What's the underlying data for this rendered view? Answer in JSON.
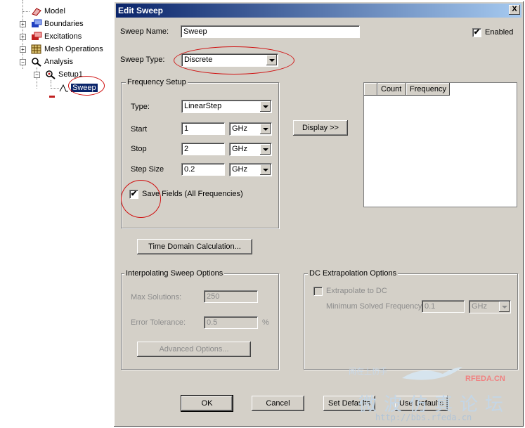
{
  "tree": {
    "items": [
      {
        "label": "Model",
        "icon": "model-icon"
      },
      {
        "label": "Boundaries",
        "icon": "boundaries-icon"
      },
      {
        "label": "Excitations",
        "icon": "excitations-icon"
      },
      {
        "label": "Mesh Operations",
        "icon": "mesh-operations-icon"
      },
      {
        "label": "Analysis",
        "icon": "analysis-icon"
      },
      {
        "label": "Setup1",
        "icon": "setup-icon"
      },
      {
        "label": "Sweep",
        "icon": "sweep-icon"
      }
    ]
  },
  "dialog": {
    "title": "Edit Sweep",
    "close_label": "X",
    "sweep_name_label": "Sweep Name:",
    "sweep_name_value": "Sweep",
    "enabled_label": "Enabled",
    "enabled_checked": true,
    "sweep_type_label": "Sweep Type:",
    "sweep_type_value": "Discrete",
    "frequency_setup": {
      "title": "Frequency Setup",
      "type_label": "Type:",
      "type_value": "LinearStep",
      "start_label": "Start",
      "start_value": "1",
      "start_unit": "GHz",
      "stop_label": "Stop",
      "stop_value": "2",
      "stop_unit": "GHz",
      "step_label": "Step Size",
      "step_value": "0.2",
      "step_unit": "GHz",
      "save_fields_label": "Save Fields (All Frequencies)",
      "save_fields_checked": true
    },
    "display_button": "Display >>",
    "table": {
      "columns": [
        "Count",
        "Frequency"
      ]
    },
    "time_domain_button": "Time Domain Calculation...",
    "interpolating": {
      "title": "Interpolating Sweep Options",
      "max_solutions_label": "Max Solutions:",
      "max_solutions_value": "250",
      "error_tolerance_label": "Error Tolerance:",
      "error_tolerance_value": "0.5",
      "error_tolerance_unit": "%",
      "advanced_button": "Advanced Options..."
    },
    "dc_extrapolation": {
      "title": "DC Extrapolation Options",
      "extrapolate_label": "Extrapolate to DC",
      "min_freq_label": "Minimum Solved Frequency",
      "min_freq_value": "0.1",
      "min_freq_unit": "GHz"
    },
    "buttons": {
      "ok": "OK",
      "cancel": "Cancel",
      "set_defaults": "Set Defaults",
      "use_defaults": "Use Defaults"
    }
  },
  "watermark": {
    "brand": "RFEDA.CN",
    "url": "http://bbs.rfeda.cn",
    "small_text": "闻在上仿手",
    "title_text": "微波仿真论坛"
  },
  "colors": {
    "titlebar_start": "#0a246a",
    "titlebar_end": "#a6caf0",
    "dialog_face": "#d4d0c8",
    "highlight_ellipse": "#d01010",
    "selection": "#0a246a"
  }
}
